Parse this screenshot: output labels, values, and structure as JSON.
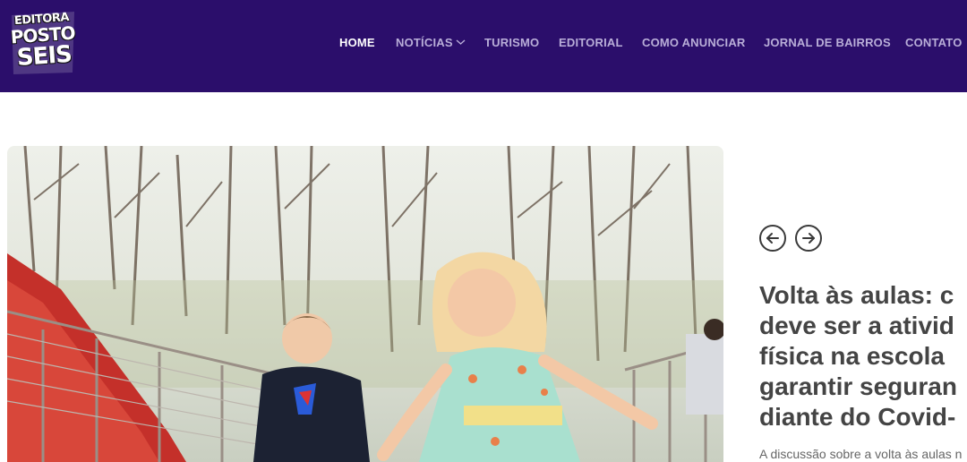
{
  "colors": {
    "header_bg": "#2b0e6b",
    "nav_text": "#b9aed8",
    "nav_active": "#ffffff",
    "headline": "#444444"
  },
  "logo": {
    "line1": "EDITORA",
    "line2": "POSTO",
    "line3": "SEIS"
  },
  "nav": {
    "items": [
      {
        "label": "HOME",
        "active": true
      },
      {
        "label": "NOTÍCIAS",
        "has_dropdown": true
      },
      {
        "label": "TURISMO"
      },
      {
        "label": "EDITORIAL"
      },
      {
        "label": "COMO ANUNCIAR"
      },
      {
        "label": "JORNAL DE BAIRROS"
      },
      {
        "label": "CONTATO"
      }
    ]
  },
  "slider": {
    "prev_icon": "arrow-left-circle-icon",
    "next_icon": "arrow-right-circle-icon",
    "image": "children-running-on-bridge-photo",
    "headline_lines": [
      "Volta às aulas: c",
      "deve ser a ativid",
      "física na escola",
      "garantir seguran",
      "diante do Covid-"
    ],
    "excerpt": "A discussão sobre a volta às aulas n"
  }
}
